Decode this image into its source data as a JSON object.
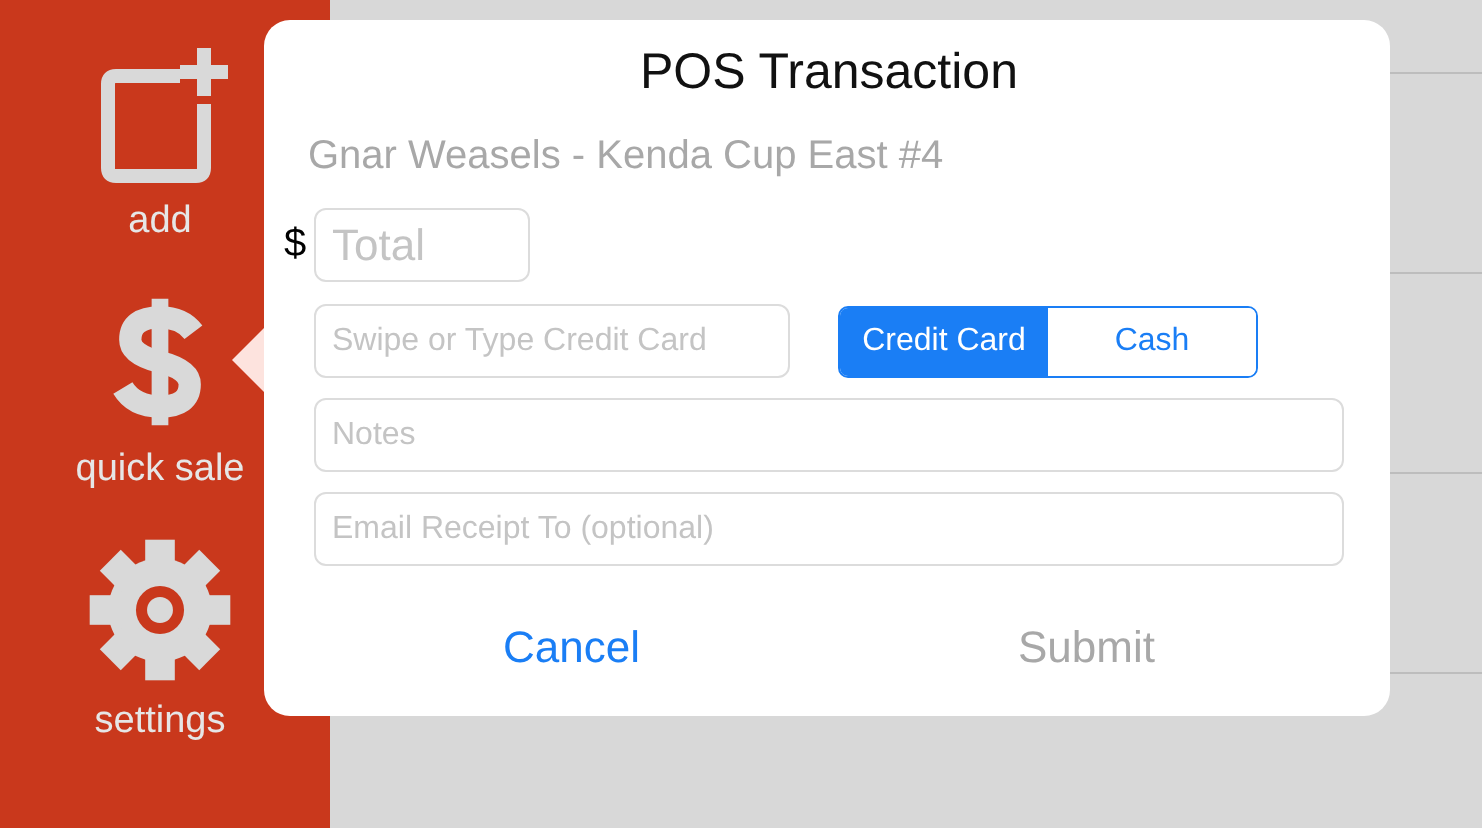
{
  "sidebar": {
    "items": [
      {
        "label": "add",
        "kind": "add",
        "selected": false
      },
      {
        "label": "quick sale",
        "kind": "dollar",
        "selected": true
      },
      {
        "label": "settings",
        "kind": "gear",
        "selected": false
      }
    ]
  },
  "dialog": {
    "title": "POS Transaction",
    "subtitle": "Gnar Weasels - Kenda Cup East #4",
    "currency": "$",
    "total": {
      "placeholder": "Total"
    },
    "card": {
      "placeholder": "Swipe or Type Credit Card"
    },
    "payment_methods": [
      {
        "label": "Credit Card",
        "selected": true
      },
      {
        "label": "Cash",
        "selected": false
      }
    ],
    "notes": {
      "placeholder": "Notes"
    },
    "email": {
      "placeholder": "Email Receipt To (optional)"
    },
    "buttons": [
      {
        "label": "Cancel",
        "disabled": false
      },
      {
        "label": "Submit",
        "disabled": true
      }
    ]
  }
}
